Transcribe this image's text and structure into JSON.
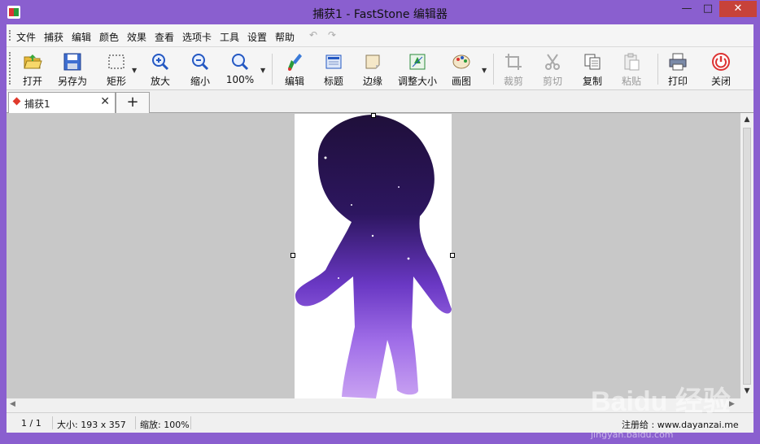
{
  "window": {
    "title": "捕获1 - FastStone 编辑器"
  },
  "window_controls": {
    "minimize": "—",
    "maximize": "□",
    "close": "✕"
  },
  "menu": [
    "文件",
    "捕获",
    "编辑",
    "颜色",
    "效果",
    "查看",
    "选项卡",
    "工具",
    "设置",
    "帮助"
  ],
  "undo_redo": {
    "undo": "↶",
    "redo": "↷"
  },
  "toolbar": {
    "open": "打开",
    "save_as": "另存为",
    "rectangle": "矩形",
    "zoom_in": "放大",
    "zoom_out": "缩小",
    "zoom_100": "100%",
    "edit": "编辑",
    "caption": "标题",
    "border": "边缘",
    "resize": "调整大小",
    "canvas": "画图",
    "crop": "裁剪",
    "cut": "剪切",
    "copy": "复制",
    "paste": "粘贴",
    "print": "打印",
    "close": "关闭"
  },
  "tabs": [
    {
      "label": "捕获1",
      "close": "✕"
    }
  ],
  "tab_add": "+",
  "status": {
    "page": "1 / 1",
    "size": "大小: 193 x 357",
    "zoom": "缩放: 100%",
    "registered": "注册给 : www.dayanzai.me"
  },
  "watermark": {
    "brand": "Baidu 经验",
    "url": "jingyan.baidu.com"
  },
  "colors": {
    "frame": "#8a5fcf",
    "close_button": "#c7423a",
    "canvas_bg": "#c8c8c8"
  }
}
